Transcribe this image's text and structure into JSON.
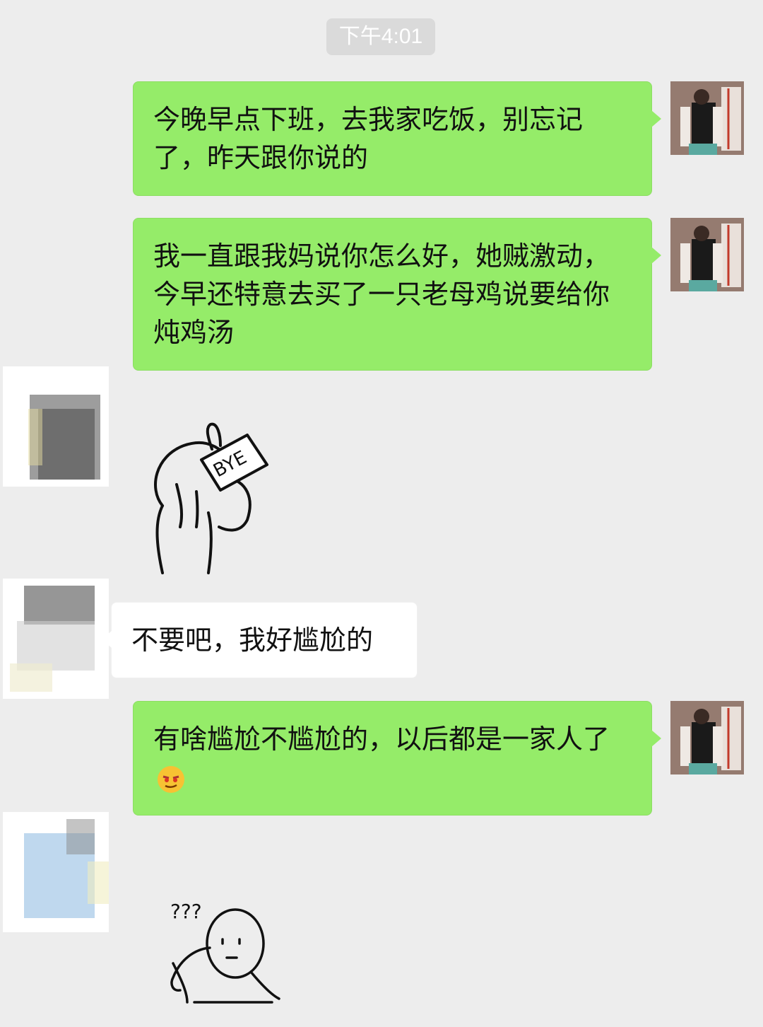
{
  "timestamp": "下午4:01",
  "messages": [
    {
      "side": "out",
      "text": "今晚早点下班，去我家吃饭，别忘记了，昨天跟你说的"
    },
    {
      "side": "out",
      "text": "我一直跟我妈说你怎么好，她贼激动，今早还特意去买了一只老母鸡说要给你炖鸡汤"
    },
    {
      "side": "in",
      "sticker": "bye-sticker",
      "sticker_text": "BYE"
    },
    {
      "side": "in",
      "text": "不要吧，我好尴尬的"
    },
    {
      "side": "out",
      "text": "有啥尴尬不尴尬的，以后都是一家人了",
      "emoji": "smirk-emoji"
    },
    {
      "side": "in",
      "sticker": "confused-sticker",
      "sticker_text": "???"
    }
  ],
  "colors": {
    "background": "#ededed",
    "outgoing_bubble": "#95ec69",
    "incoming_bubble": "#ffffff",
    "timestamp_bg": "#dadada"
  }
}
